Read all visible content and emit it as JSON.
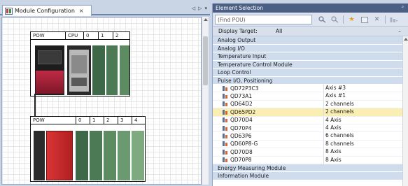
{
  "editor": {
    "tab_title": "Module Configuration",
    "tab_close": "×",
    "pane_controls": [
      "◁",
      "▷",
      "▾"
    ],
    "main_base": {
      "slots": [
        "POW",
        "CPU",
        "0",
        "1",
        "2"
      ]
    },
    "ext_base": {
      "slots": [
        "POW",
        "0",
        "1",
        "2",
        "3",
        "4"
      ]
    }
  },
  "element_selection": {
    "title": "Element Selection",
    "pin": "ᵖ",
    "find_placeholder": "(Find POU)",
    "toolbar_icons": [
      "find-icon",
      "find-next-icon",
      "favorites-star-icon",
      "module-icon",
      "delete-icon",
      "display-icon"
    ],
    "display_target_label": "Display Target:",
    "display_target_value": "All",
    "categories_top": [
      "Analog Output",
      "Analog I/O",
      "Temperature Input",
      "Temperature Control Module",
      "Loop Control",
      "Pulse I/O, Positioning"
    ],
    "items": [
      {
        "name": "QD72P3C3",
        "desc": "Axis #3",
        "selected": false
      },
      {
        "name": "QD73A1",
        "desc": "Axis #1",
        "selected": false
      },
      {
        "name": "QD64D2",
        "desc": "2 channels",
        "selected": false
      },
      {
        "name": "QD65PD2",
        "desc": "2 channels",
        "selected": true
      },
      {
        "name": "QD70D4",
        "desc": "4 Axis",
        "selected": false
      },
      {
        "name": "QD70P4",
        "desc": "4 Axis",
        "selected": false
      },
      {
        "name": "QD63P6",
        "desc": "6 channels",
        "selected": false
      },
      {
        "name": "QD60P8-G",
        "desc": "8 channels",
        "selected": false
      },
      {
        "name": "QD70D8",
        "desc": "8 Axis",
        "selected": false
      },
      {
        "name": "QD70P8",
        "desc": "8 Axis",
        "selected": false
      }
    ],
    "categories_bottom": [
      "Energy Measuring Module",
      "Information Module"
    ]
  },
  "colors": {
    "title_bar": "#4b5f84",
    "category_bg": "#cfdced",
    "selected_row": "#fbeeb2",
    "power_module_red": "#b0233a",
    "io_module_green": "#3f6e4a"
  }
}
